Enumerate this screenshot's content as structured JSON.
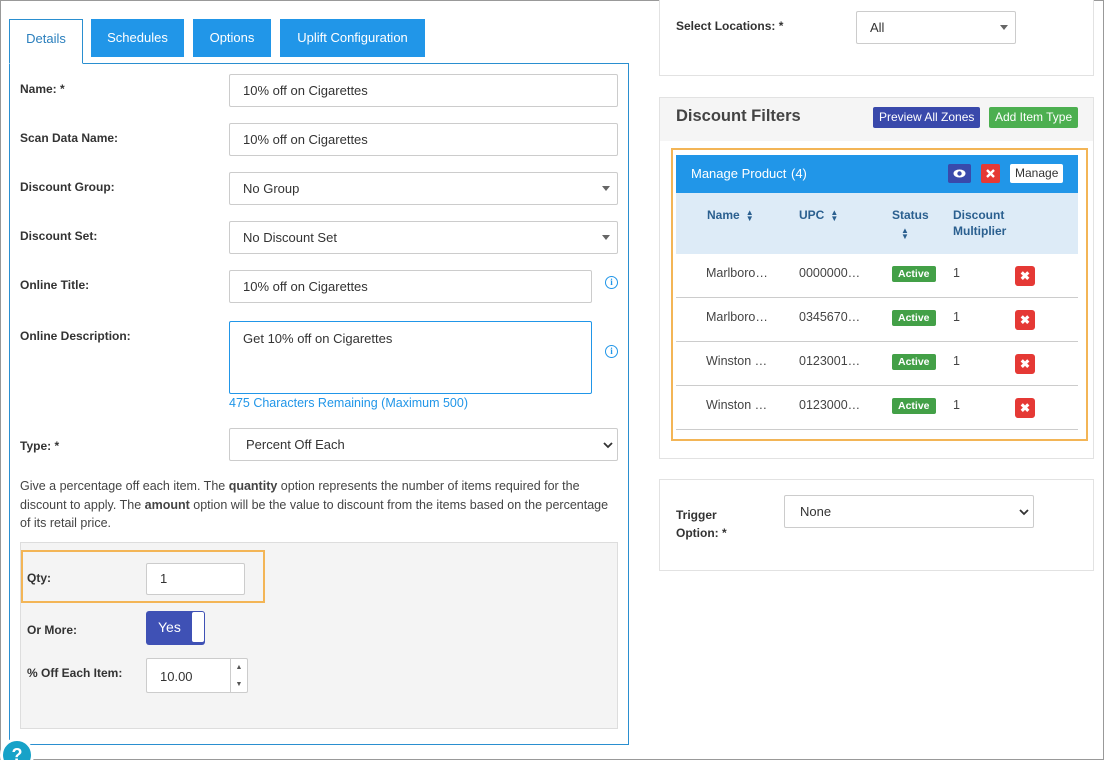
{
  "tabs": [
    {
      "label": "Details"
    },
    {
      "label": "Schedules"
    },
    {
      "label": "Options"
    },
    {
      "label": "Uplift Configuration"
    }
  ],
  "form": {
    "name_label": "Name: *",
    "name_value": "10% off on Cigarettes",
    "scan_label": "Scan Data Name:",
    "scan_value": "10% off on Cigarettes",
    "group_label": "Discount Group:",
    "group_value": "No Group",
    "set_label": "Discount Set:",
    "set_value": "No Discount Set",
    "online_title_label": "Online Title:",
    "online_title_value": "10% off on Cigarettes",
    "online_desc_label": "Online Description:",
    "online_desc_value": "Get 10% off on Cigarettes",
    "chars_remaining": "475 Characters Remaining (Maximum 500)",
    "type_label": "Type: *",
    "type_value": "Percent Off Each",
    "help_part1": "Give a percentage off each item. The ",
    "help_bold1": "quantity",
    "help_part2": " option represents the number of items required for the discount to apply. The ",
    "help_bold2": "amount",
    "help_part3": " option will be the value to discount from the items based on the percentage of its retail price.",
    "qty_label": "Qty:",
    "qty_value": "1",
    "or_more_label": "Or More:",
    "or_more_value": "Yes",
    "off_each_label": "% Off Each Item:",
    "off_each_value": "10.00"
  },
  "locations": {
    "label": "Select Locations: *",
    "value": "All"
  },
  "filters": {
    "title": "Discount Filters",
    "preview_btn": "Preview All Zones",
    "add_btn": "Add Item Type",
    "manage_title": "Manage Product",
    "manage_count": "(4)",
    "manage_btn": "Manage",
    "columns": {
      "name": "Name",
      "upc": "UPC",
      "status": "Status",
      "multiplier": "Discount Multiplier"
    },
    "rows": [
      {
        "name": "Marlboro…",
        "upc": "0000000…",
        "status": "Active",
        "multiplier": "1"
      },
      {
        "name": "Marlboro…",
        "upc": "0345670…",
        "status": "Active",
        "multiplier": "1"
      },
      {
        "name": "Winston …",
        "upc": "0123001…",
        "status": "Active",
        "multiplier": "1"
      },
      {
        "name": "Winston …",
        "upc": "0123000…",
        "status": "Active",
        "multiplier": "1"
      }
    ]
  },
  "trigger": {
    "label_line1": "Trigger",
    "label_line2": "Option: *",
    "value": "None"
  },
  "help_button": "?",
  "icons": {
    "info": "info-icon",
    "sort": "sort-icon",
    "eye": "eye-icon",
    "close": "close-icon",
    "delete": "delete-icon",
    "chevron": "chevron-down-icon"
  },
  "colors": {
    "accent": "#2196e8",
    "active": "#43a047",
    "danger": "#e53935",
    "toggle": "#3f51b5",
    "highlight": "#f3b556"
  }
}
